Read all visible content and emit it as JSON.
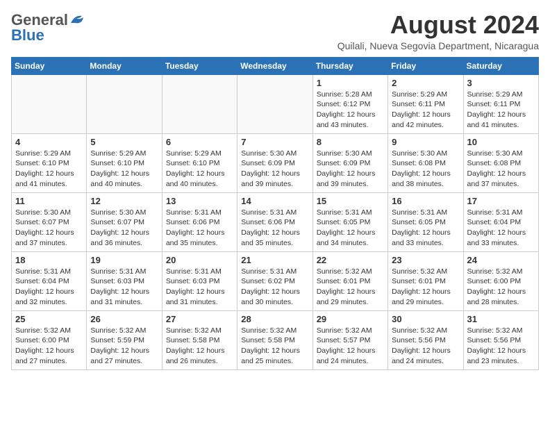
{
  "header": {
    "logo_general": "General",
    "logo_blue": "Blue",
    "title": "August 2024",
    "subtitle": "Quilali, Nueva Segovia Department, Nicaragua"
  },
  "days_of_week": [
    "Sunday",
    "Monday",
    "Tuesday",
    "Wednesday",
    "Thursday",
    "Friday",
    "Saturday"
  ],
  "weeks": [
    [
      {
        "day": "",
        "info": ""
      },
      {
        "day": "",
        "info": ""
      },
      {
        "day": "",
        "info": ""
      },
      {
        "day": "",
        "info": ""
      },
      {
        "day": "1",
        "info": "Sunrise: 5:28 AM\nSunset: 6:12 PM\nDaylight: 12 hours\nand 43 minutes."
      },
      {
        "day": "2",
        "info": "Sunrise: 5:29 AM\nSunset: 6:11 PM\nDaylight: 12 hours\nand 42 minutes."
      },
      {
        "day": "3",
        "info": "Sunrise: 5:29 AM\nSunset: 6:11 PM\nDaylight: 12 hours\nand 41 minutes."
      }
    ],
    [
      {
        "day": "4",
        "info": "Sunrise: 5:29 AM\nSunset: 6:10 PM\nDaylight: 12 hours\nand 41 minutes."
      },
      {
        "day": "5",
        "info": "Sunrise: 5:29 AM\nSunset: 6:10 PM\nDaylight: 12 hours\nand 40 minutes."
      },
      {
        "day": "6",
        "info": "Sunrise: 5:29 AM\nSunset: 6:10 PM\nDaylight: 12 hours\nand 40 minutes."
      },
      {
        "day": "7",
        "info": "Sunrise: 5:30 AM\nSunset: 6:09 PM\nDaylight: 12 hours\nand 39 minutes."
      },
      {
        "day": "8",
        "info": "Sunrise: 5:30 AM\nSunset: 6:09 PM\nDaylight: 12 hours\nand 39 minutes."
      },
      {
        "day": "9",
        "info": "Sunrise: 5:30 AM\nSunset: 6:08 PM\nDaylight: 12 hours\nand 38 minutes."
      },
      {
        "day": "10",
        "info": "Sunrise: 5:30 AM\nSunset: 6:08 PM\nDaylight: 12 hours\nand 37 minutes."
      }
    ],
    [
      {
        "day": "11",
        "info": "Sunrise: 5:30 AM\nSunset: 6:07 PM\nDaylight: 12 hours\nand 37 minutes."
      },
      {
        "day": "12",
        "info": "Sunrise: 5:30 AM\nSunset: 6:07 PM\nDaylight: 12 hours\nand 36 minutes."
      },
      {
        "day": "13",
        "info": "Sunrise: 5:31 AM\nSunset: 6:06 PM\nDaylight: 12 hours\nand 35 minutes."
      },
      {
        "day": "14",
        "info": "Sunrise: 5:31 AM\nSunset: 6:06 PM\nDaylight: 12 hours\nand 35 minutes."
      },
      {
        "day": "15",
        "info": "Sunrise: 5:31 AM\nSunset: 6:05 PM\nDaylight: 12 hours\nand 34 minutes."
      },
      {
        "day": "16",
        "info": "Sunrise: 5:31 AM\nSunset: 6:05 PM\nDaylight: 12 hours\nand 33 minutes."
      },
      {
        "day": "17",
        "info": "Sunrise: 5:31 AM\nSunset: 6:04 PM\nDaylight: 12 hours\nand 33 minutes."
      }
    ],
    [
      {
        "day": "18",
        "info": "Sunrise: 5:31 AM\nSunset: 6:04 PM\nDaylight: 12 hours\nand 32 minutes."
      },
      {
        "day": "19",
        "info": "Sunrise: 5:31 AM\nSunset: 6:03 PM\nDaylight: 12 hours\nand 31 minutes."
      },
      {
        "day": "20",
        "info": "Sunrise: 5:31 AM\nSunset: 6:03 PM\nDaylight: 12 hours\nand 31 minutes."
      },
      {
        "day": "21",
        "info": "Sunrise: 5:31 AM\nSunset: 6:02 PM\nDaylight: 12 hours\nand 30 minutes."
      },
      {
        "day": "22",
        "info": "Sunrise: 5:32 AM\nSunset: 6:01 PM\nDaylight: 12 hours\nand 29 minutes."
      },
      {
        "day": "23",
        "info": "Sunrise: 5:32 AM\nSunset: 6:01 PM\nDaylight: 12 hours\nand 29 minutes."
      },
      {
        "day": "24",
        "info": "Sunrise: 5:32 AM\nSunset: 6:00 PM\nDaylight: 12 hours\nand 28 minutes."
      }
    ],
    [
      {
        "day": "25",
        "info": "Sunrise: 5:32 AM\nSunset: 6:00 PM\nDaylight: 12 hours\nand 27 minutes."
      },
      {
        "day": "26",
        "info": "Sunrise: 5:32 AM\nSunset: 5:59 PM\nDaylight: 12 hours\nand 27 minutes."
      },
      {
        "day": "27",
        "info": "Sunrise: 5:32 AM\nSunset: 5:58 PM\nDaylight: 12 hours\nand 26 minutes."
      },
      {
        "day": "28",
        "info": "Sunrise: 5:32 AM\nSunset: 5:58 PM\nDaylight: 12 hours\nand 25 minutes."
      },
      {
        "day": "29",
        "info": "Sunrise: 5:32 AM\nSunset: 5:57 PM\nDaylight: 12 hours\nand 24 minutes."
      },
      {
        "day": "30",
        "info": "Sunrise: 5:32 AM\nSunset: 5:56 PM\nDaylight: 12 hours\nand 24 minutes."
      },
      {
        "day": "31",
        "info": "Sunrise: 5:32 AM\nSunset: 5:56 PM\nDaylight: 12 hours\nand 23 minutes."
      }
    ]
  ]
}
